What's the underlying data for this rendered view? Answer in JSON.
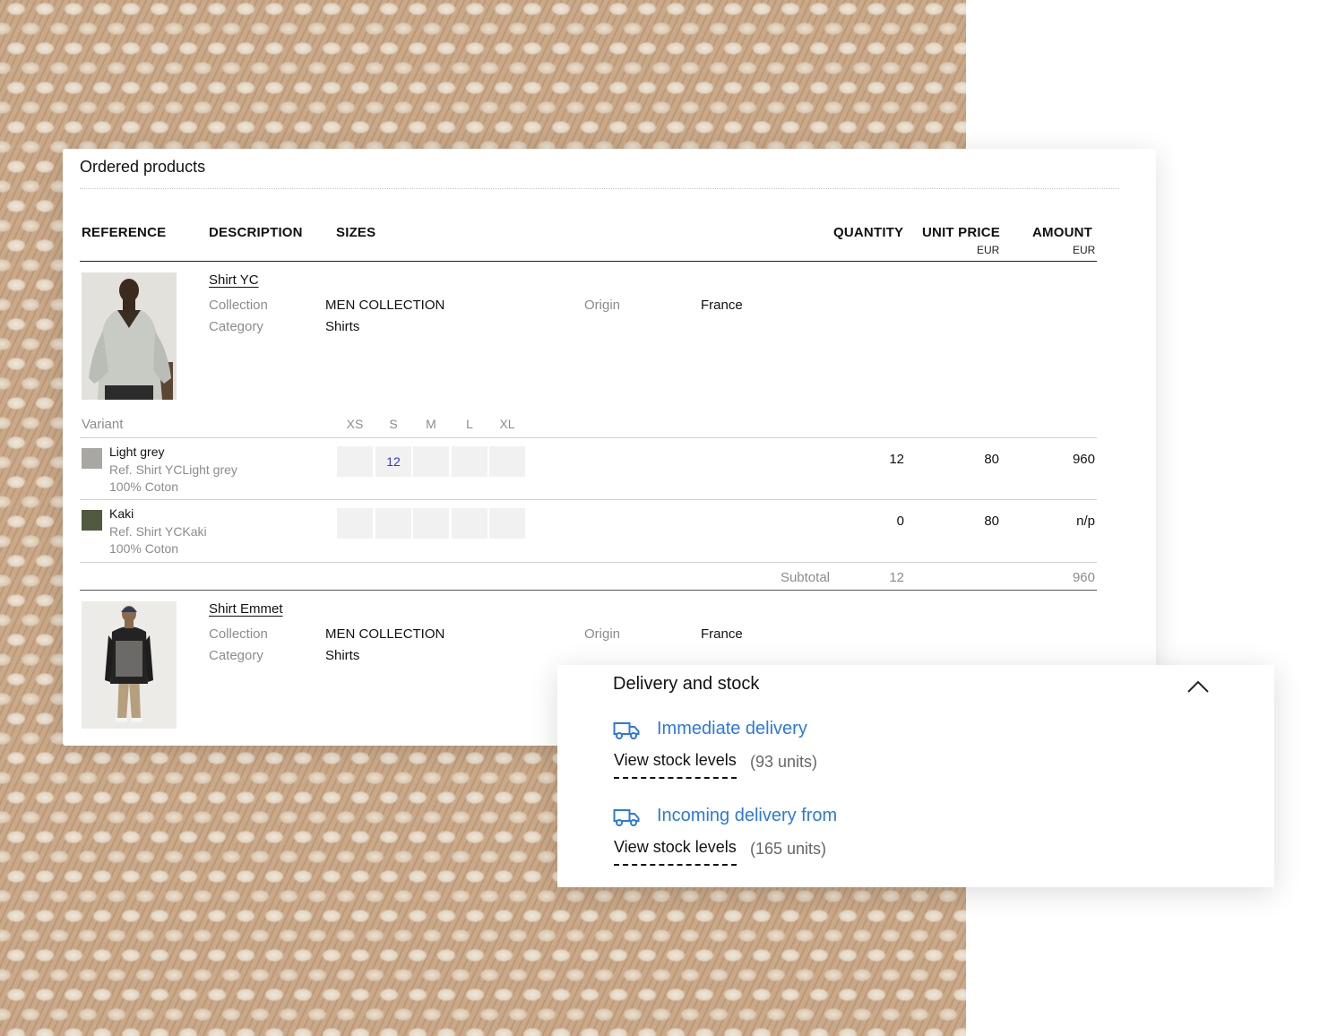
{
  "panel": {
    "title": "Ordered products"
  },
  "columns": {
    "reference": "REFERENCE",
    "description": "DESCRIPTION",
    "sizes": "SIZES",
    "quantity": "QUANTITY",
    "unit_price": "UNIT PRICE",
    "unit_price_currency": "EUR",
    "amount": "AMOUNT",
    "amount_currency": "EUR"
  },
  "sizes": [
    "XS",
    "S",
    "M",
    "L",
    "XL"
  ],
  "variant_label": "Variant",
  "products": [
    {
      "name": "Shirt YC",
      "collection_label": "Collection",
      "collection": "MEN COLLECTION",
      "category_label": "Category",
      "category": "Shirts",
      "origin_label": "Origin",
      "origin": "France",
      "variants": [
        {
          "name": "Light grey",
          "ref": "Ref. Shirt YCLight grey",
          "material": "100% Coton",
          "swatch_color": "#a9a7a1",
          "size_qty": [
            "",
            "12",
            "",
            "",
            ""
          ],
          "quantity": "12",
          "unit_price": "80",
          "amount": "960"
        },
        {
          "name": "Kaki",
          "ref": "Ref. Shirt YCKaki",
          "material": "100% Coton",
          "swatch_color": "#4f5a3f",
          "size_qty": [
            "",
            "",
            "",
            "",
            ""
          ],
          "quantity": "0",
          "unit_price": "80",
          "amount": "n/p"
        }
      ],
      "subtotal_label": "Subtotal",
      "subtotal_quantity": "12",
      "subtotal_amount": "960"
    },
    {
      "name": "Shirt Emmet",
      "collection_label": "Collection",
      "collection": "MEN COLLECTION",
      "category_label": "Category",
      "category": "Shirts",
      "origin_label": "Origin",
      "origin": "France"
    }
  ],
  "delivery": {
    "title": "Delivery and stock",
    "chevron_icon": "chevron-up-icon",
    "options": [
      {
        "icon": "truck-icon",
        "label": "Immediate delivery",
        "stock_link": "View stock levels",
        "units": "(93 units)"
      },
      {
        "icon": "truck-icon",
        "label": "Incoming delivery from",
        "stock_link": "View stock levels",
        "units": "(165 units)"
      }
    ]
  },
  "colors": {
    "link_blue": "#2b78e4",
    "size_qty_blue": "#2b3bd6",
    "muted_grey": "#8c8c8c"
  }
}
